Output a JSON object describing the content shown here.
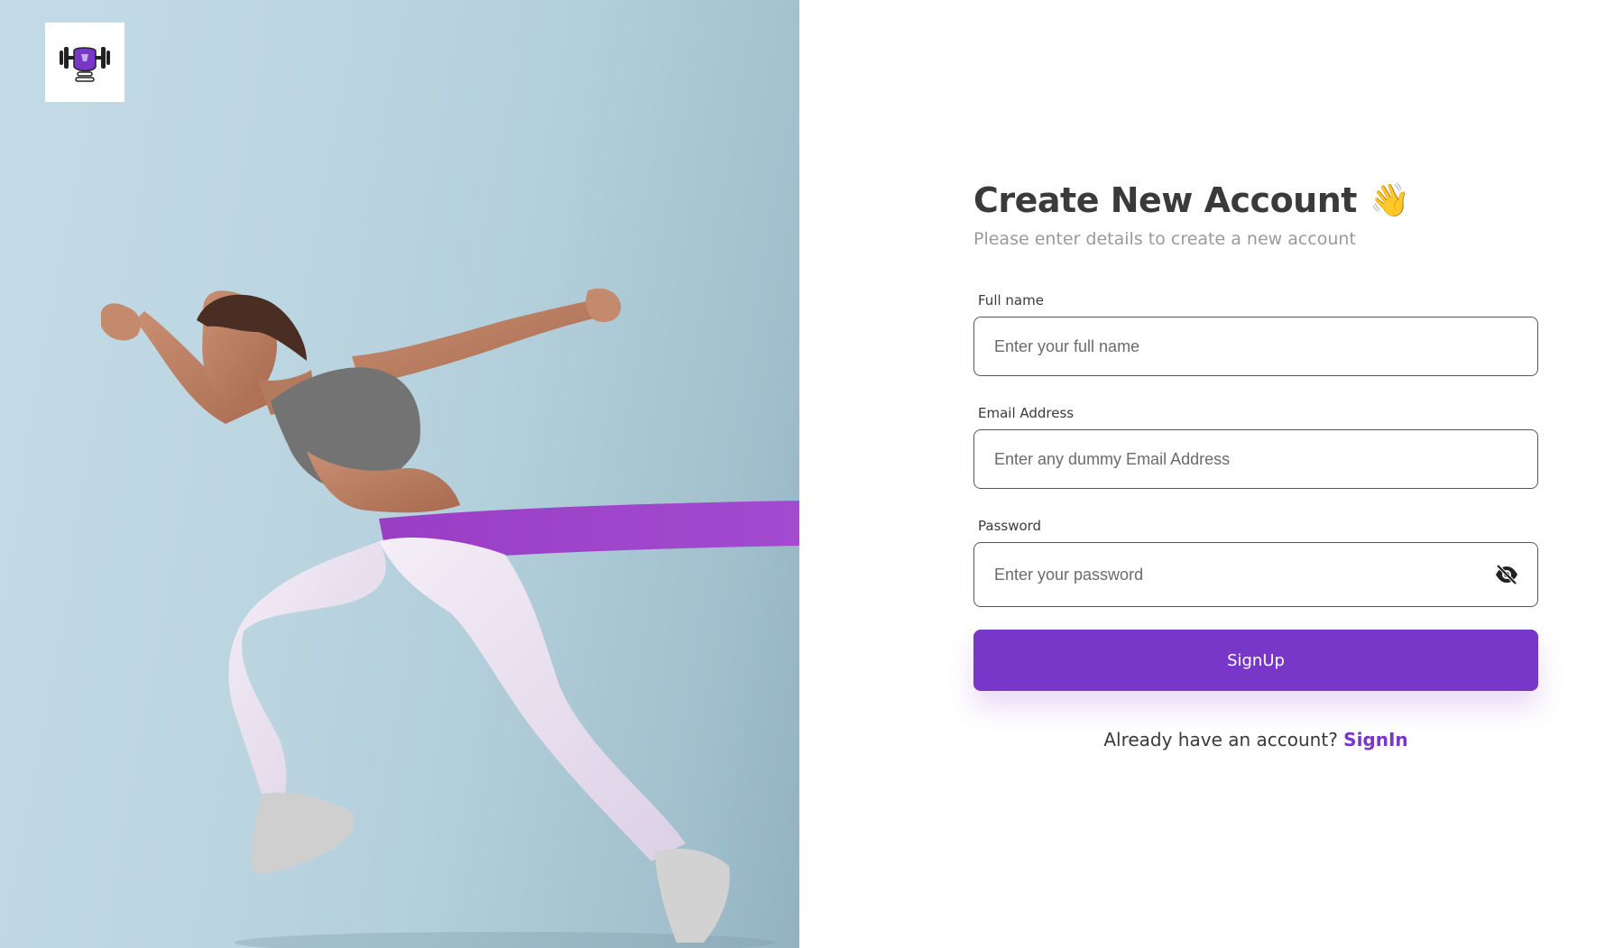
{
  "brand": {
    "logo_icon": "dumbbell-fist-icon",
    "accent_color": "#7837c8"
  },
  "hero": {
    "image": "woman-sprinting-with-resistance-band-photo"
  },
  "form": {
    "title": "Create New Account",
    "title_emoji": "👋",
    "subtitle": "Please enter details to create a new account",
    "full_name": {
      "label": "Full name",
      "placeholder": "Enter your full name",
      "value": ""
    },
    "email": {
      "label": "Email Address",
      "placeholder": "Enter any dummy Email Address",
      "value": ""
    },
    "password": {
      "label": "Password",
      "placeholder": "Enter your password",
      "value": "",
      "toggle_icon": "eye-off-icon"
    },
    "submit_label": "SignUp",
    "signin_prompt": "Already have an account?",
    "signin_link": "SignIn"
  }
}
